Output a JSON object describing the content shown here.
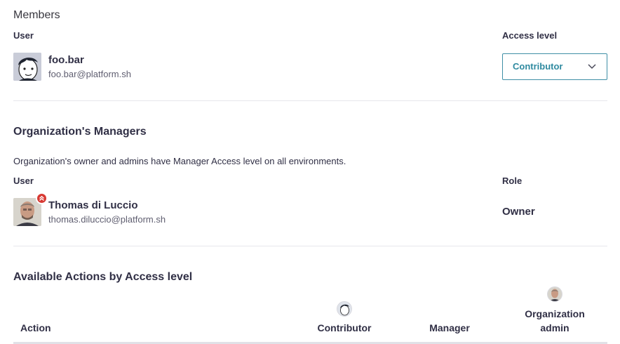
{
  "members": {
    "title": "Members",
    "user_header": "User",
    "access_header": "Access level",
    "user": {
      "name": "foo.bar",
      "email": "foo.bar@platform.sh",
      "avatar_icon": "cartoon-face-avatar-icon"
    },
    "access_select": {
      "value": "Contributor"
    }
  },
  "managers": {
    "title": "Organization's Managers",
    "note": "Organization's owner and admins have Manager Access level on all environments.",
    "user_header": "User",
    "role_header": "Role",
    "user": {
      "name": "Thomas di Luccio",
      "email": "thomas.diluccio@platform.sh",
      "role": "Owner",
      "badge_icon": "double-chevron-up-icon"
    }
  },
  "actions": {
    "title": "Available Actions by Access level",
    "columns": {
      "action": "Action",
      "contributor": "Contributor",
      "manager": "Manager",
      "org_admin_line1": "Organization",
      "org_admin_line2": "admin"
    }
  },
  "colors": {
    "accent": "#2f8aa0",
    "badge": "#d83a33",
    "divider": "#e7e7ec"
  }
}
